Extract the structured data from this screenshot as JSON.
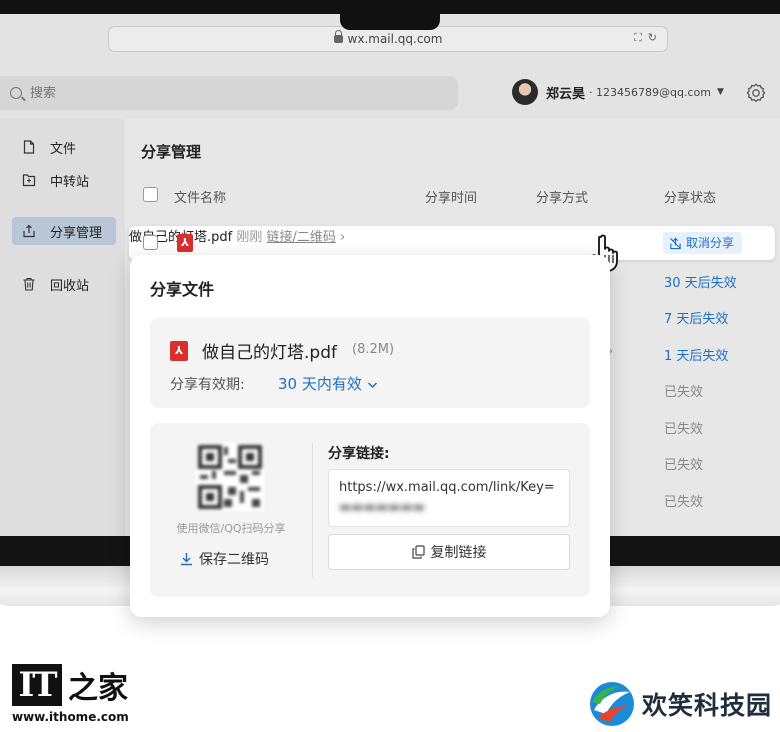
{
  "browser": {
    "url": "wx.mail.qq.com"
  },
  "header": {
    "search_placeholder": "搜索",
    "user_name": "郑云昊",
    "user_email": "· 123456789@qq.com"
  },
  "sidebar": {
    "items": [
      {
        "label": "文件",
        "icon": "file-icon"
      },
      {
        "label": "中转站",
        "icon": "transfer-station-icon"
      },
      {
        "label": "分享管理",
        "icon": "share-icon",
        "active": true
      },
      {
        "label": "回收站",
        "icon": "trash-icon"
      }
    ]
  },
  "main": {
    "title": "分享管理",
    "columns": [
      "文件名称",
      "分享时间",
      "分享方式",
      "分享状态"
    ],
    "first_row": {
      "file_name": "做自己的灯塔.pdf",
      "time": "刚刚",
      "method": "链接/二维码",
      "status_action": "取消分享"
    },
    "statuses": [
      "30 天后失效",
      "7 天后失效",
      "1 天后失效",
      "已失效",
      "已失效",
      "已失效",
      "已失效"
    ]
  },
  "popover": {
    "title": "分享文件",
    "file_name": "做自己的灯塔.pdf",
    "file_size": "(8.2M)",
    "validity_label": "分享有效期:",
    "validity_value": "30 天内有效",
    "qr_hint": "使用微信/QQ扫码分享",
    "save_qr": "保存二维码",
    "link_label": "分享链接:",
    "link_url": "https://wx.mail.qq.com/link/Key=",
    "copy_label": "复制链接"
  },
  "watermarks": {
    "it_url": "www.ithome.com",
    "it_mark": "IT",
    "it_chars": "之家",
    "hx_name": "欢笑科技园"
  },
  "colors": {
    "accent": "#1e6fc4",
    "pdf_red": "#d9302e"
  }
}
